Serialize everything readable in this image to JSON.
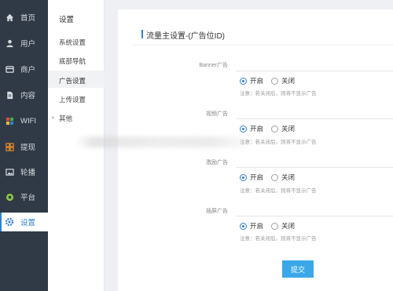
{
  "sidebar": {
    "items": [
      {
        "label": "首页",
        "icon": "home-icon",
        "color": "#d7dbe0"
      },
      {
        "label": "用户",
        "icon": "user-icon",
        "color": "#d7dbe0"
      },
      {
        "label": "商户",
        "icon": "merchant-icon",
        "color": "#d7dbe0"
      },
      {
        "label": "内容",
        "icon": "document-icon",
        "color": "#d7dbe0"
      },
      {
        "label": "WIFI",
        "icon": "wifi-grid-icon",
        "color": "#d7dbe0"
      },
      {
        "label": "提现",
        "icon": "withdraw-grid-icon",
        "color": "#e6892b"
      },
      {
        "label": "轮播",
        "icon": "image-icon",
        "color": "#d7dbe0"
      },
      {
        "label": "平台",
        "icon": "platform-icon",
        "color": "#8bc34a"
      },
      {
        "label": "设置",
        "icon": "gear-icon",
        "color": "#2f7fd6",
        "active": true
      }
    ]
  },
  "subnav": {
    "title": "设置",
    "items": [
      "系统设置",
      "底部导航",
      "广告设置",
      "上传设置",
      "其他"
    ],
    "active_index": 2
  },
  "main": {
    "title": "流量主设置-(广告位ID)",
    "fields": [
      {
        "label": "Banner广告",
        "on_label": "开启",
        "off_label": "关闭",
        "note": "注意：若关闭后，则将不显示广告"
      },
      {
        "label": "视频广告",
        "on_label": "开启",
        "off_label": "关闭",
        "note": "注意：若关闭后，则将不显示广告"
      },
      {
        "label": "激励广告",
        "on_label": "开启",
        "off_label": "关闭",
        "note": "注意：若关闭后，则将不显示广告"
      },
      {
        "label": "插屏广告",
        "on_label": "开启",
        "off_label": "关闭",
        "note": "注意：若关闭后，则将不显示广告"
      }
    ],
    "submit_label": "提交"
  },
  "colors": {
    "sidebar_bg": "#2f3a46",
    "accent": "#2f7fd6",
    "button": "#3aa8e8"
  }
}
